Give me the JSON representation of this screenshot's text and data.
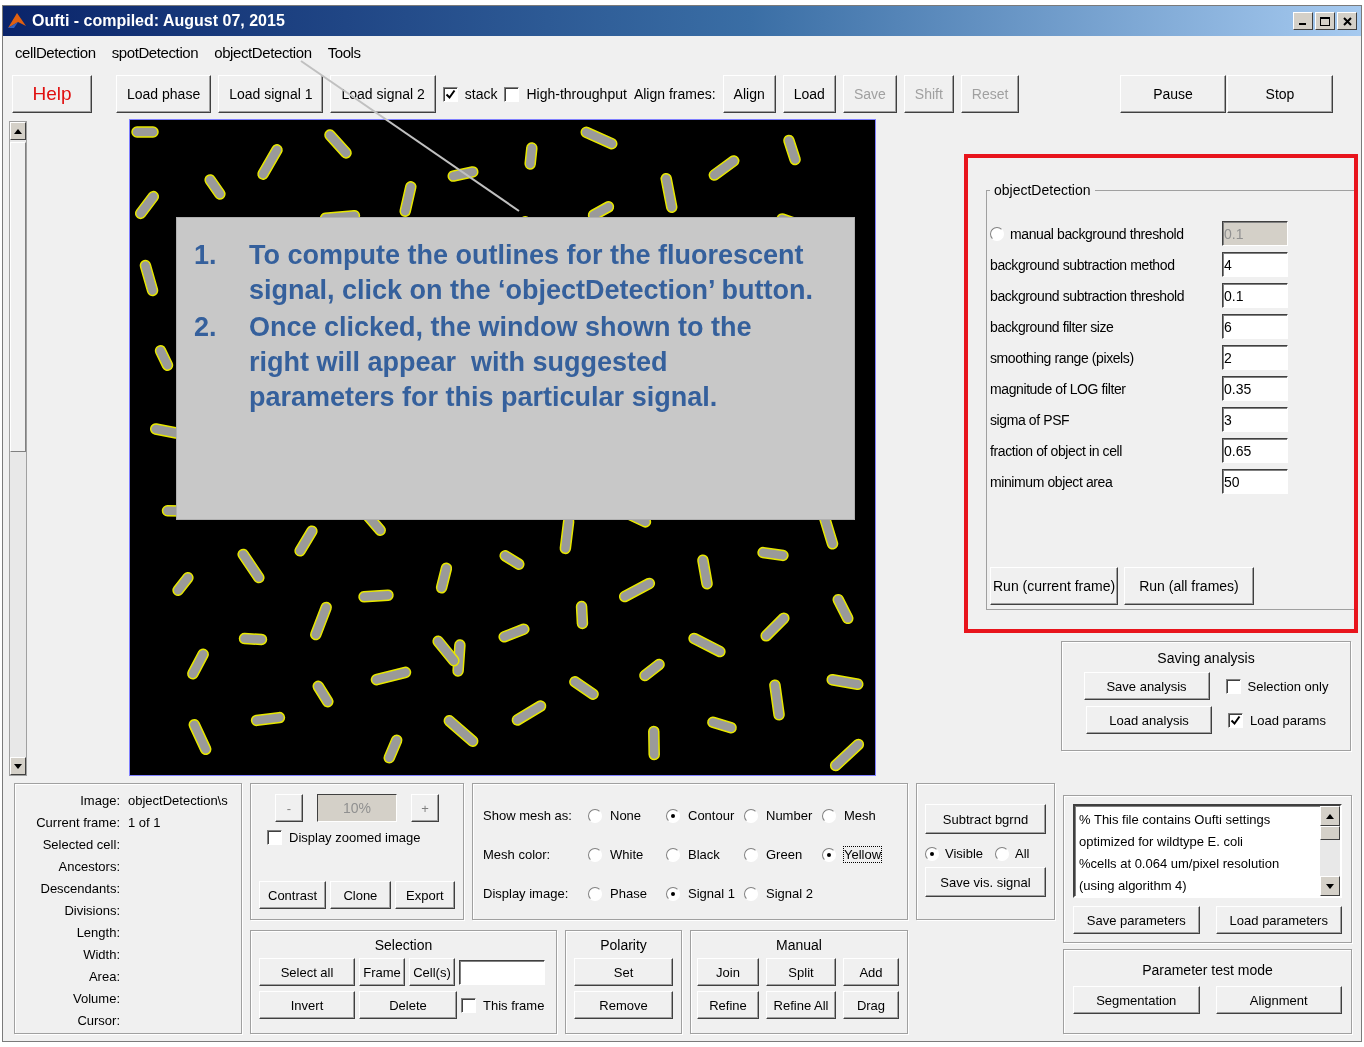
{
  "window": {
    "title": "Oufti - compiled:  August 07, 2015"
  },
  "menu": [
    "cellDetection",
    "spotDetection",
    "objectDetection",
    "Tools"
  ],
  "toolbar": [
    {
      "kind": "help",
      "label": "Help",
      "disabled": false
    },
    {
      "kind": "button",
      "label": "Load phase",
      "disabled": false
    },
    {
      "kind": "button",
      "label": "Load signal 1",
      "disabled": false
    },
    {
      "kind": "button",
      "label": "Load signal 2",
      "disabled": false
    },
    {
      "kind": "checkbox",
      "label": "stack",
      "checked": true
    },
    {
      "kind": "checkbox",
      "label": "High-throughput",
      "checked": false
    },
    {
      "kind": "label",
      "label": "Align frames:"
    },
    {
      "kind": "button",
      "label": "Align",
      "disabled": false
    },
    {
      "kind": "button",
      "label": "Load",
      "disabled": false
    },
    {
      "kind": "button",
      "label": "Save",
      "disabled": true
    },
    {
      "kind": "button",
      "label": "Shift",
      "disabled": true
    },
    {
      "kind": "button",
      "label": "Reset",
      "disabled": true
    }
  ],
  "run_controls": [
    "Pause",
    "Stop"
  ],
  "callout": [
    {
      "number": "1.",
      "text": "To compute the outlines for the fluorescent signal, click on the ‘objectDetection’ button."
    },
    {
      "number": "2.",
      "text": "Once clicked, the window shown to the right will appear  with suggested parameters for this particular signal."
    }
  ],
  "object_detection": {
    "title": "objectDetection",
    "params": [
      {
        "kind": "radio",
        "label": "manual background threshold",
        "value": "0.1",
        "checked": false,
        "disabled": true
      },
      {
        "kind": "plain",
        "label": "background subtraction method",
        "value": "4",
        "disabled": false
      },
      {
        "kind": "plain",
        "label": "background subtraction threshold",
        "value": "0.1",
        "disabled": false
      },
      {
        "kind": "plain",
        "label": "background filter size",
        "value": "6",
        "disabled": false
      },
      {
        "kind": "plain",
        "label": "smoothing range (pixels)",
        "value": "2",
        "disabled": false
      },
      {
        "kind": "plain",
        "label": "magnitude of LOG filter",
        "value": "0.35",
        "disabled": false
      },
      {
        "kind": "plain",
        "label": "sigma of PSF",
        "value": "3",
        "disabled": false
      },
      {
        "kind": "plain",
        "label": "fraction of object in cell",
        "value": "0.65",
        "disabled": false
      },
      {
        "kind": "plain",
        "label": "minimum object area",
        "value": "50",
        "disabled": false
      }
    ],
    "buttons": [
      "Run (current frame)",
      "Run (all frames)"
    ]
  },
  "saving_analysis": {
    "title": "Saving analysis",
    "buttons": [
      "Save analysis",
      "Load analysis"
    ],
    "checkboxes": [
      {
        "label": "Selection only",
        "checked": false
      },
      {
        "label": "Load params",
        "checked": true
      }
    ]
  },
  "cell_info": [
    {
      "label": "Image:",
      "value": "objectDetection\\s"
    },
    {
      "label": "Current frame:",
      "value": "1 of 1"
    },
    {
      "label": "Selected cell:"
    },
    {
      "label": "Ancestors:"
    },
    {
      "label": "Descendants:"
    },
    {
      "label": "Divisions:"
    },
    {
      "label": "Length:"
    },
    {
      "label": "Width:"
    },
    {
      "label": "Area:"
    },
    {
      "label": "Volume:"
    },
    {
      "label": "Cursor:"
    }
  ],
  "zoom": {
    "minus": "-",
    "value": "10%",
    "plus": "+",
    "display_zoomed": {
      "label": "Display zoomed image",
      "checked": false
    },
    "buttons": [
      "Contrast",
      "Clone",
      "Export"
    ]
  },
  "display_options": [
    {
      "label": "Show mesh as:",
      "options": [
        {
          "label": "None",
          "selected": false
        },
        {
          "label": "Contour",
          "selected": true
        },
        {
          "label": "Number",
          "selected": false
        },
        {
          "label": "Mesh",
          "selected": false
        }
      ]
    },
    {
      "label": "Mesh color:",
      "options": [
        {
          "label": "White",
          "selected": false
        },
        {
          "label": "Black",
          "selected": false
        },
        {
          "label": "Green",
          "selected": false
        },
        {
          "label": "Yellow",
          "selected": true
        }
      ]
    },
    {
      "label": "Display image:",
      "options": [
        {
          "label": "Phase",
          "selected": false
        },
        {
          "label": "Signal 1",
          "selected": true
        },
        {
          "label": "Signal 2",
          "selected": false
        }
      ]
    }
  ],
  "selection": {
    "title": "Selection",
    "row1": [
      "Select all",
      "Frame",
      "Cell(s)"
    ],
    "row2": [
      "Invert",
      "Delete"
    ],
    "this_frame": {
      "label": "This frame",
      "checked": false
    }
  },
  "polarity": {
    "title": "Polarity",
    "buttons": [
      "Set",
      "Remove"
    ]
  },
  "manual": {
    "title": "Manual",
    "buttons": [
      "Join",
      "Split",
      "Add",
      "Refine",
      "Refine All",
      "Drag"
    ]
  },
  "signal": {
    "buttons": [
      "Subtract bgrnd",
      "Save vis. signal"
    ],
    "scope": [
      {
        "label": "Visible",
        "selected": true
      },
      {
        "label": "All",
        "selected": false
      }
    ]
  },
  "parameters": {
    "text": [
      "% This file contains Oufti settings",
      "optimized for wildtype E. coli",
      "%cells at 0.064 um/pixel resolution",
      "(using algorithm 4)"
    ],
    "buttons": [
      "Save parameters",
      "Load parameters"
    ]
  },
  "test_mode": {
    "title": "Parameter test mode",
    "buttons": [
      "Segmentation",
      "Alignment"
    ]
  }
}
